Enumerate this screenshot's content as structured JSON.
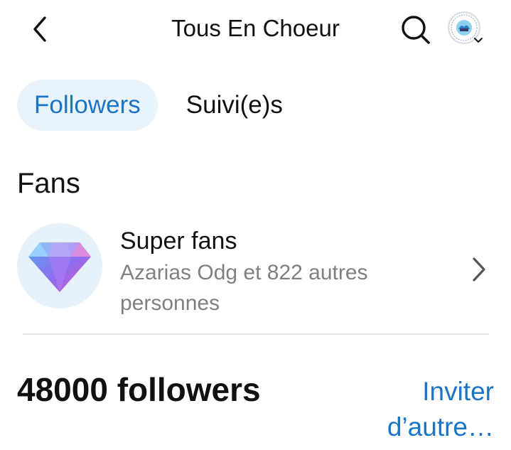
{
  "header": {
    "title": "Tous En Choeur",
    "back_icon": "chevron-left-icon",
    "search_icon": "search-icon",
    "avatar_icon": "profile-avatar"
  },
  "tabs": [
    {
      "label": "Followers",
      "active": true
    },
    {
      "label": "Suivi(e)s",
      "active": false
    }
  ],
  "fans_section": {
    "title": "Fans",
    "super_fans": {
      "title": "Super fans",
      "description": "Azarias Odg et 822 autres personnes",
      "icon": "diamond-icon"
    }
  },
  "followers": {
    "count_label": "48000 followers",
    "invite_label": "Inviter d’autre…"
  },
  "colors": {
    "accent": "#1b74c8",
    "tab_active_bg": "#e8f3fc",
    "secondary_text": "#808080"
  }
}
